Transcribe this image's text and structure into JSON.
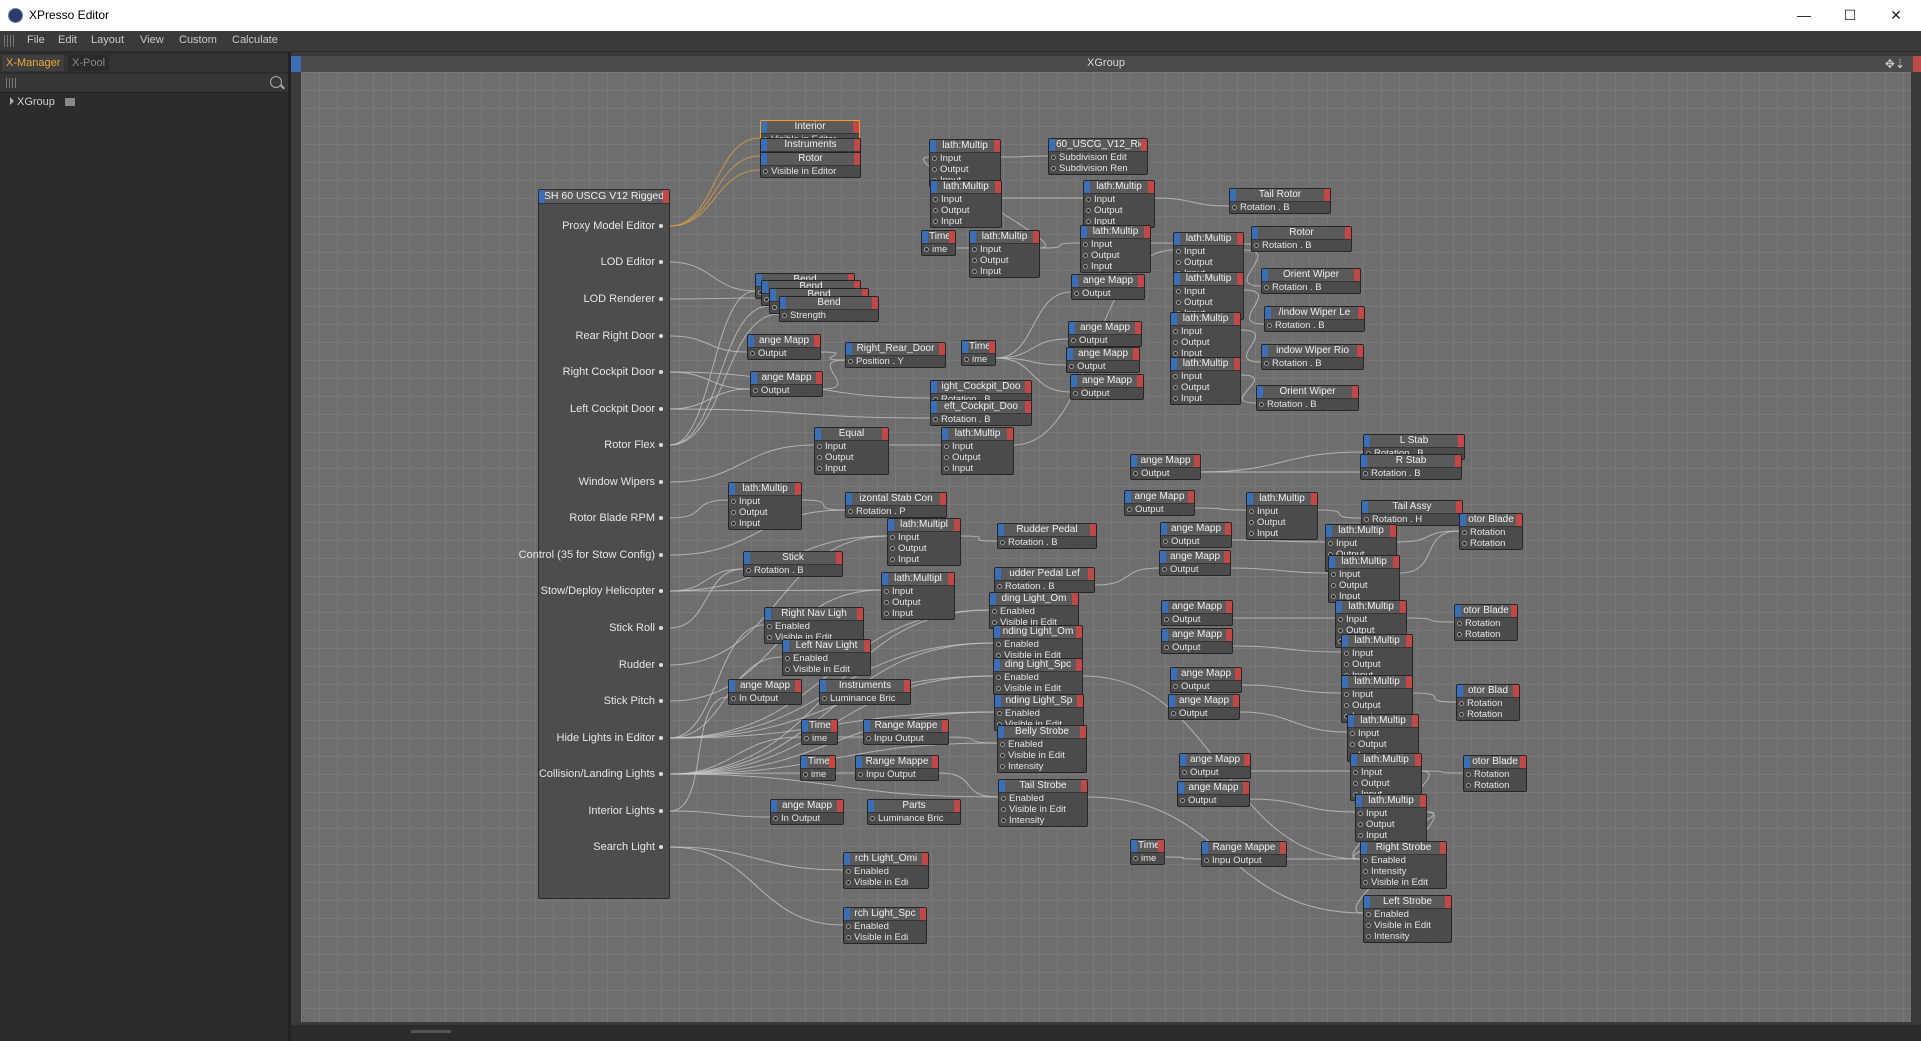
{
  "window": {
    "title": "XPresso Editor",
    "controls": [
      "—",
      "☐",
      "✕"
    ]
  },
  "menu": [
    "File",
    "Edit",
    "Layout",
    "View",
    "Custom",
    "Calculate"
  ],
  "left_panel": {
    "tabs": [
      "X-Manager",
      "X-Pool"
    ],
    "tree": [
      {
        "label": "XGroup"
      }
    ]
  },
  "editor": {
    "title": "XGroup",
    "tools": "✥⇣"
  },
  "main_node": {
    "title": "SH 60 USCG V12 Rigged",
    "ports": [
      "Proxy Model Editor",
      "LOD Editor",
      "LOD Renderer",
      "Rear Right Door",
      "Right Cockpit Door",
      "Left Cockpit Door",
      "Rotor Flex",
      "Window Wipers",
      "Rotor Blade RPM",
      "Control (35 for Stow Config)",
      "Stow/Deploy Helicopter",
      "Stick Roll",
      "Rudder",
      "Stick Pitch",
      "Hide Lights in Editor",
      "Collision/Landing  Lights",
      "Interior Lights",
      "Search Light"
    ]
  },
  "nodes": [
    {
      "title": "Interior",
      "ports": [
        "Visible in Editor"
      ]
    },
    {
      "title": "Instruments",
      "ports": [
        "Visible in Editor"
      ]
    },
    {
      "title": "Rotor",
      "ports": [
        "Visible in Editor"
      ]
    },
    {
      "title": "lath:Multip",
      "ports": [
        "Input",
        "Output",
        "Input"
      ]
    },
    {
      "title": "60_USCG_V12_Ric",
      "ports": [
        "Subdivision Edit",
        "Subdivision Ren"
      ]
    },
    {
      "title": "lath:Multip",
      "ports": [
        "Input",
        "Output",
        "Input"
      ]
    },
    {
      "title": "lath:Multip",
      "ports": [
        "Input",
        "Output",
        "Input"
      ]
    },
    {
      "title": "Tail Rotor",
      "ports": [
        "Rotation . B"
      ]
    },
    {
      "title": "Time",
      "ports": [
        "ime"
      ]
    },
    {
      "title": "lath:Multip",
      "ports": [
        "Input",
        "Output",
        "Input"
      ]
    },
    {
      "title": "lath:Multip",
      "ports": [
        "Input",
        "Output",
        "Input"
      ]
    },
    {
      "title": "Rotor",
      "ports": [
        "Rotation . B"
      ]
    },
    {
      "title": "Bend",
      "ports": [
        "Strength"
      ]
    },
    {
      "title": "Bend",
      "ports": [
        "Strength"
      ]
    },
    {
      "title": "Bend",
      "ports": [
        "Strength"
      ]
    },
    {
      "title": "Bend",
      "ports": [
        "Strength"
      ]
    },
    {
      "title": "ange Mapp",
      "ports": [
        "Output"
      ]
    },
    {
      "title": "lath:Multip",
      "ports": [
        "Input",
        "Output",
        "Input"
      ]
    },
    {
      "title": "Orient Wiper",
      "ports": [
        "Rotation . B"
      ]
    },
    {
      "title": "ange Mapp",
      "ports": [
        "Output"
      ]
    },
    {
      "title": "lath:Multip",
      "ports": [
        "Input",
        "Output",
        "Input"
      ]
    },
    {
      "title": "/indow Wiper Le",
      "ports": [
        "Rotation . B"
      ]
    },
    {
      "title": "ange Mapp",
      "ports": [
        "Output"
      ]
    },
    {
      "title": "Right_Rear_Door",
      "ports": [
        "Position . Y"
      ]
    },
    {
      "title": "Time",
      "ports": [
        "ime"
      ]
    },
    {
      "title": "ange Mapp",
      "ports": [
        "Output"
      ]
    },
    {
      "title": "lath:Multip",
      "ports": [
        "Input",
        "Output",
        "Input"
      ]
    },
    {
      "title": "indow Wiper Rio",
      "ports": [
        "Rotation . B"
      ]
    },
    {
      "title": "ange Mapp",
      "ports": [
        "Output"
      ]
    },
    {
      "title": "ange Mapp",
      "ports": [
        "Output"
      ]
    },
    {
      "title": "lath:Multip",
      "ports": [
        "Input",
        "Output",
        "Input"
      ]
    },
    {
      "title": "ight_Cockpit_Doo",
      "ports": [
        "Rotation . B"
      ]
    },
    {
      "title": "Orient Wiper",
      "ports": [
        "Rotation . B"
      ]
    },
    {
      "title": "eft_Cockpit_Doo",
      "ports": [
        "Rotation . B"
      ]
    },
    {
      "title": "Equal",
      "ports": [
        "Input",
        "Output",
        "Input"
      ]
    },
    {
      "title": "lath:Multip",
      "ports": [
        "Input",
        "Output",
        "Input"
      ]
    },
    {
      "title": "L Stab",
      "ports": [
        "Rotation . B"
      ]
    },
    {
      "title": "ange Mapp",
      "ports": [
        "Output"
      ]
    },
    {
      "title": "R Stab",
      "ports": [
        "Rotation . B"
      ]
    },
    {
      "title": "lath:Multip",
      "ports": [
        "Input",
        "Output",
        "Input"
      ]
    },
    {
      "title": "izontal Stab Con",
      "ports": [
        "Rotation . P"
      ]
    },
    {
      "title": "ange Mapp",
      "ports": [
        "Output"
      ]
    },
    {
      "title": "lath:Multip",
      "ports": [
        "Input",
        "Output",
        "Input"
      ]
    },
    {
      "title": "Tail Assy",
      "ports": [
        "Rotation . H"
      ]
    },
    {
      "title": "lath:Multipl",
      "ports": [
        "Input",
        "Output",
        "Input"
      ]
    },
    {
      "title": "Rudder Pedal",
      "ports": [
        "Rotation . B"
      ]
    },
    {
      "title": "ange Mapp",
      "ports": [
        "Output"
      ]
    },
    {
      "title": "lath:Multip",
      "ports": [
        "Input",
        "Output",
        "Input"
      ]
    },
    {
      "title": "otor Blade",
      "ports": [
        "Rotation",
        "Rotation"
      ]
    },
    {
      "title": "Stick",
      "ports": [
        "Rotation . B"
      ]
    },
    {
      "title": "udder Pedal Lef",
      "ports": [
        "Rotation . B"
      ]
    },
    {
      "title": "ange Mapp",
      "ports": [
        "Output"
      ]
    },
    {
      "title": "lath:Multip",
      "ports": [
        "Input",
        "Output",
        "Input"
      ]
    },
    {
      "title": "lath:Multipl",
      "ports": [
        "Input",
        "Output",
        "Input"
      ]
    },
    {
      "title": "ding Light_Om",
      "ports": [
        "Enabled",
        "Visible in Edit"
      ]
    },
    {
      "title": "ange Mapp",
      "ports": [
        "Output"
      ]
    },
    {
      "title": "lath:Multip",
      "ports": [
        "Input",
        "Output",
        "Input"
      ]
    },
    {
      "title": "otor Blade",
      "ports": [
        "Rotation",
        "Rotation"
      ]
    },
    {
      "title": "Right Nav Ligh",
      "ports": [
        "Enabled",
        "Visible in Edit"
      ]
    },
    {
      "title": "nding Light_Om",
      "ports": [
        "Enabled",
        "Visible in Edit"
      ]
    },
    {
      "title": "ange Mapp",
      "ports": [
        "Output"
      ]
    },
    {
      "title": "lath:Multip",
      "ports": [
        "Input",
        "Output",
        "Input"
      ]
    },
    {
      "title": "Left Nav Light",
      "ports": [
        "Enabled",
        "Visible in Edit"
      ]
    },
    {
      "title": "ding Light_Spc",
      "ports": [
        "Enabled",
        "Visible in Edit"
      ]
    },
    {
      "title": "ange Mapp",
      "ports": [
        "Output"
      ]
    },
    {
      "title": "lath:Multip",
      "ports": [
        "Input",
        "Output",
        "Input"
      ]
    },
    {
      "title": "ange Mapp",
      "ports": [
        "In Output"
      ]
    },
    {
      "title": "Instruments",
      "ports": [
        "Luminance Bric"
      ]
    },
    {
      "title": "nding Light_Sp",
      "ports": [
        "Enabled",
        "Visible in Edit"
      ]
    },
    {
      "title": "ange Mapp",
      "ports": [
        "Output"
      ]
    },
    {
      "title": "otor Blad",
      "ports": [
        "Rotation",
        "Rotation"
      ]
    },
    {
      "title": "lath:Multip",
      "ports": [
        "Input",
        "Output",
        "Input"
      ]
    },
    {
      "title": "Time",
      "ports": [
        "ime"
      ]
    },
    {
      "title": "Range Mappe",
      "ports": [
        "Inpu Output"
      ]
    },
    {
      "title": "Belly Strobe",
      "ports": [
        "Enabled",
        "Visible in Edit",
        "Intensity"
      ]
    },
    {
      "title": "ange Mapp",
      "ports": [
        "Output"
      ]
    },
    {
      "title": "lath:Multip",
      "ports": [
        "Input",
        "Output",
        "Input"
      ]
    },
    {
      "title": "otor Blade",
      "ports": [
        "Rotation",
        "Rotation"
      ]
    },
    {
      "title": "Time",
      "ports": [
        "ime"
      ]
    },
    {
      "title": "Range Mappe",
      "ports": [
        "Inpu Output"
      ]
    },
    {
      "title": "Tail Strobe",
      "ports": [
        "Enabled",
        "Visible in Edit",
        "Intensity"
      ]
    },
    {
      "title": "ange Mapp",
      "ports": [
        "Output"
      ]
    },
    {
      "title": "lath:Multip",
      "ports": [
        "Input",
        "Output",
        "Input"
      ]
    },
    {
      "title": "ange Mapp",
      "ports": [
        "In Output"
      ]
    },
    {
      "title": "Parts",
      "ports": [
        "Luminance Bric"
      ]
    },
    {
      "title": "Time",
      "ports": [
        "ime"
      ]
    },
    {
      "title": "Range Mappe",
      "ports": [
        "Inpu Output"
      ]
    },
    {
      "title": "Right Strobe",
      "ports": [
        "Enabled",
        "Intensity",
        "Visible in Edit"
      ]
    },
    {
      "title": "rch Light_Omi",
      "ports": [
        "Enabled",
        "Visible in Edi"
      ]
    },
    {
      "title": "Left Strobe",
      "ports": [
        "Enabled",
        "Visible in Edit",
        "Intensity"
      ]
    },
    {
      "title": "rch Light_Spc",
      "ports": [
        "Enabled",
        "Visible in Edi"
      ]
    }
  ]
}
